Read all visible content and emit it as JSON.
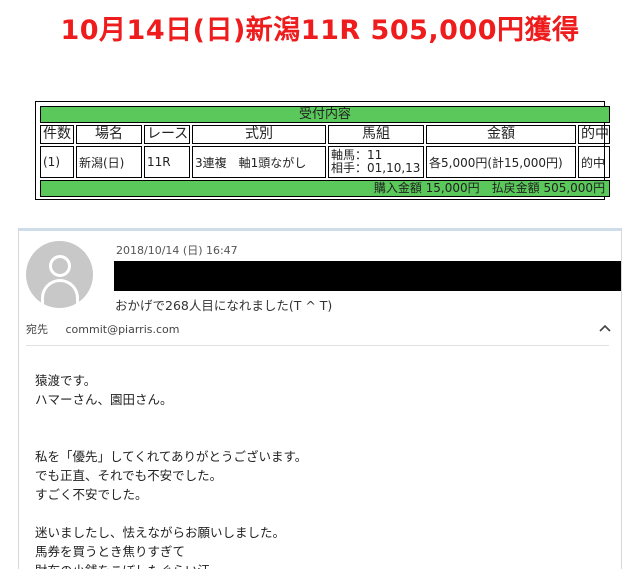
{
  "headline": "10月14日(日)新潟11R 505,000円獲得",
  "ticket": {
    "caption": "受付内容",
    "headers": [
      "件数",
      "場名",
      "レース",
      "式別",
      "馬組",
      "金額",
      "的中"
    ],
    "row": {
      "count": "(1)",
      "venue": "新潟(日)",
      "race": "11R",
      "bet_type": "3連複　軸1頭ながし",
      "axis": "軸馬：11",
      "partners": "相手：01,10,13",
      "amount": "各5,000円(計15,000円)",
      "hit": "的中"
    },
    "footer": "購入金額 15,000円　払戻金額 505,000円"
  },
  "email": {
    "date": "2018/10/14 (日) 16:47",
    "subject": "おかげで268人目になれました(T ^ T)",
    "to_label": "宛先",
    "to_address": "commit@piarris.com",
    "body": {
      "p1": [
        "猿渡です。",
        "ハマーさん、園田さん。"
      ],
      "p2": [
        "私を「優先」してくれてありがとうございます。",
        "でも正直、それでも不安でした。",
        "すごく不安でした。"
      ],
      "p3": [
        "迷いましたし、怯えながらお願いしました。",
        "馬券を買うとき焦りすぎて",
        "財布の小銭をこぼしたぐらい汗"
      ]
    }
  }
}
